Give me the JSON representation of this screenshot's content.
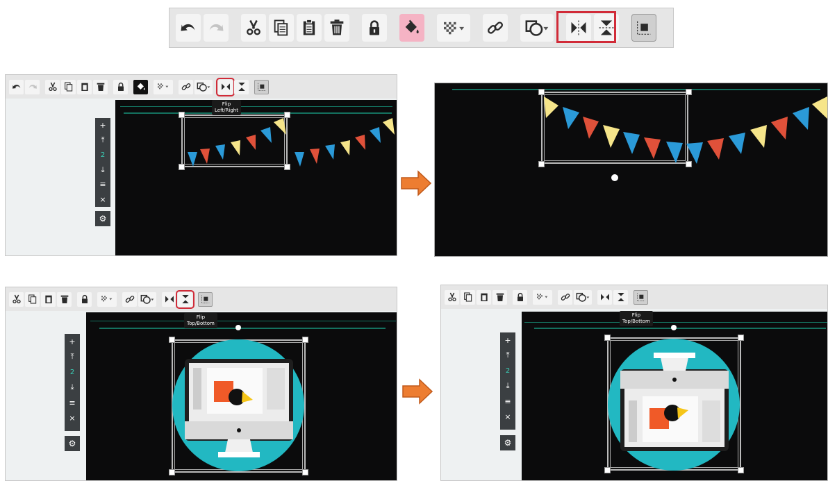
{
  "toolbar_icons": [
    "undo-icon",
    "redo-icon",
    "cut-icon",
    "copy-icon",
    "paste-icon",
    "delete-icon",
    "lock-icon",
    "fill-icon",
    "transparency-icon",
    "link-icon",
    "shape-icon",
    "flip-left-right-icon",
    "flip-top-bottom-icon",
    "arrange-icon"
  ],
  "tooltips": {
    "flip_lr": {
      "line1": "Flip",
      "line2": "Left/Right"
    },
    "flip_tb1": {
      "line1": "Flip",
      "line2": "Top/Bottom"
    },
    "flip_tb2": {
      "line1": "Flip",
      "line2": "Top/Bottom"
    }
  },
  "layers": {
    "num1": "2",
    "num2": "2",
    "num3": "2"
  },
  "colors": {
    "highlight": "#d12b38",
    "canvas": "#0b0b0c",
    "accent_line": "#14715f",
    "arrow": "#ed7d31",
    "flag_red": "#e0513a",
    "flag_yellow": "#f6e58a",
    "flag_blue": "#2b9ad8",
    "circle_teal": "#22b8c2"
  }
}
